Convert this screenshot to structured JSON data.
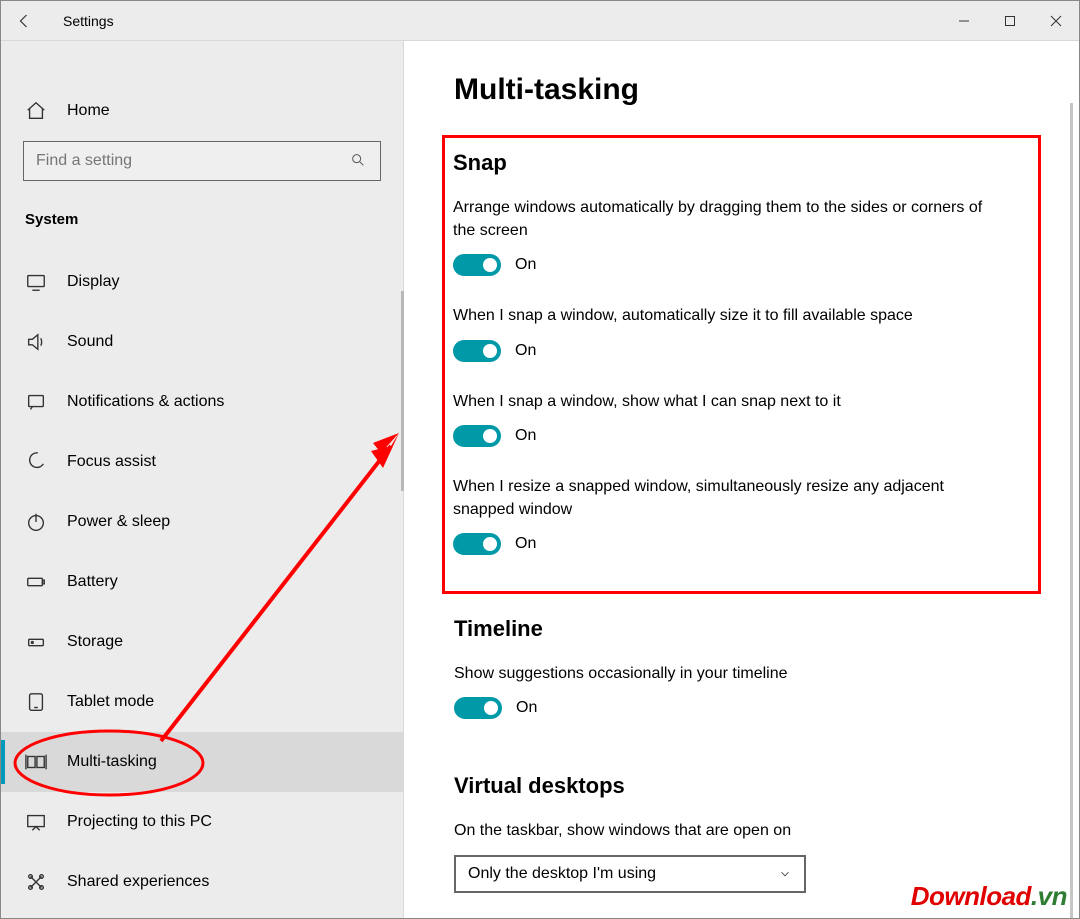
{
  "window": {
    "title": "Settings"
  },
  "sidebar": {
    "home": "Home",
    "search_placeholder": "Find a setting",
    "section": "System",
    "items": [
      {
        "label": "Display"
      },
      {
        "label": "Sound"
      },
      {
        "label": "Notifications & actions"
      },
      {
        "label": "Focus assist"
      },
      {
        "label": "Power & sleep"
      },
      {
        "label": "Battery"
      },
      {
        "label": "Storage"
      },
      {
        "label": "Tablet mode"
      },
      {
        "label": "Multi-tasking"
      },
      {
        "label": "Projecting to this PC"
      },
      {
        "label": "Shared experiences"
      }
    ]
  },
  "content": {
    "page_title": "Multi-tasking",
    "snap": {
      "heading": "Snap",
      "opt1": {
        "label": "Arrange windows automatically by dragging them to the sides or corners of the screen",
        "state": "On"
      },
      "opt2": {
        "label": "When I snap a window, automatically size it to fill available space",
        "state": "On"
      },
      "opt3": {
        "label": "When I snap a window, show what I can snap next to it",
        "state": "On"
      },
      "opt4": {
        "label": "When I resize a snapped window, simultaneously resize any adjacent snapped window",
        "state": "On"
      }
    },
    "timeline": {
      "heading": "Timeline",
      "opt1": {
        "label": "Show suggestions occasionally in your timeline",
        "state": "On"
      }
    },
    "virtual_desktops": {
      "heading": "Virtual desktops",
      "label": "On the taskbar, show windows that are open on",
      "selected": "Only the desktop I'm using"
    }
  },
  "watermark": {
    "part1": "Download",
    "part2": ".vn"
  }
}
